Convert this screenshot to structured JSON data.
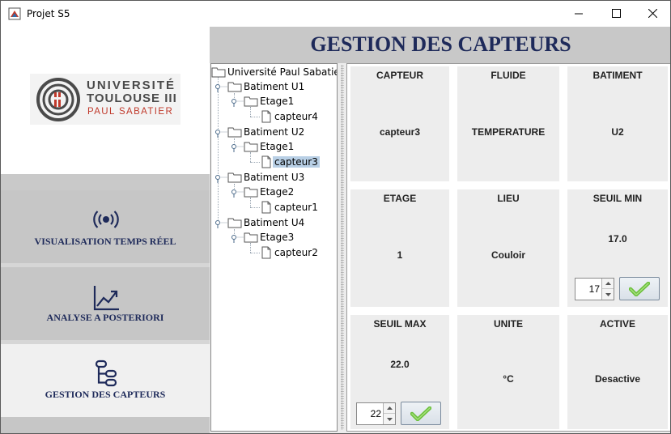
{
  "window": {
    "title": "Projet S5",
    "icon": "java-app-icon",
    "controls": [
      "minimize-icon",
      "maximize-icon",
      "close-icon"
    ]
  },
  "logo": {
    "line1": "UNIVERSITÉ",
    "line2": "TOULOUSE III",
    "line3": "PAUL SABATIER"
  },
  "nav": {
    "items": [
      {
        "label": "VISUALISATION TEMPS RÉEL",
        "icon": "broadcast-icon",
        "active": false
      },
      {
        "label": "ANALYSE A POSTERIORI",
        "icon": "chart-trend-icon",
        "active": false
      },
      {
        "label": "GESTION DES CAPTEURS",
        "icon": "nodes-icon",
        "active": true
      }
    ]
  },
  "header": {
    "title": "GESTION DES CAPTEURS"
  },
  "tree": {
    "root": "Université Paul Sabatier",
    "buildings": [
      {
        "label": "Batiment U1",
        "floors": [
          {
            "label": "Etage1",
            "sensors": [
              "capteur4"
            ]
          }
        ]
      },
      {
        "label": "Batiment U2",
        "floors": [
          {
            "label": "Etage1",
            "sensors": [
              "capteur3"
            ]
          }
        ]
      },
      {
        "label": "Batiment U3",
        "floors": [
          {
            "label": "Etage2",
            "sensors": [
              "capteur1"
            ]
          }
        ]
      },
      {
        "label": "Batiment U4",
        "floors": [
          {
            "label": "Etage3",
            "sensors": [
              "capteur2"
            ]
          }
        ]
      }
    ],
    "selected": "capteur3"
  },
  "details": {
    "capteur": {
      "label": "CAPTEUR",
      "value": "capteur3"
    },
    "fluide": {
      "label": "FLUIDE",
      "value": "TEMPERATURE"
    },
    "batiment": {
      "label": "BATIMENT",
      "value": "U2"
    },
    "etage": {
      "label": "ETAGE",
      "value": "1"
    },
    "lieu": {
      "label": "LIEU",
      "value": "Couloir"
    },
    "seuil_min": {
      "label": "SEUIL MIN",
      "value": "17.0",
      "spinner": "17"
    },
    "seuil_max": {
      "label": "SEUIL MAX",
      "value": "22.0",
      "spinner": "22"
    },
    "unite": {
      "label": "UNITE",
      "value": "°C"
    },
    "active": {
      "label": "ACTIVE",
      "value": "Desactive"
    }
  },
  "colors": {
    "nav_bg": "#c6c6c6",
    "nav_active_bg": "#f0f0f0",
    "nav_text": "#1e2a5a",
    "header_bg": "#c8c8c8",
    "cell_bg": "#ededed",
    "tree_selected": "#b8cfe5",
    "logo_red": "#c0392b",
    "check_green": "#6abf3a"
  }
}
